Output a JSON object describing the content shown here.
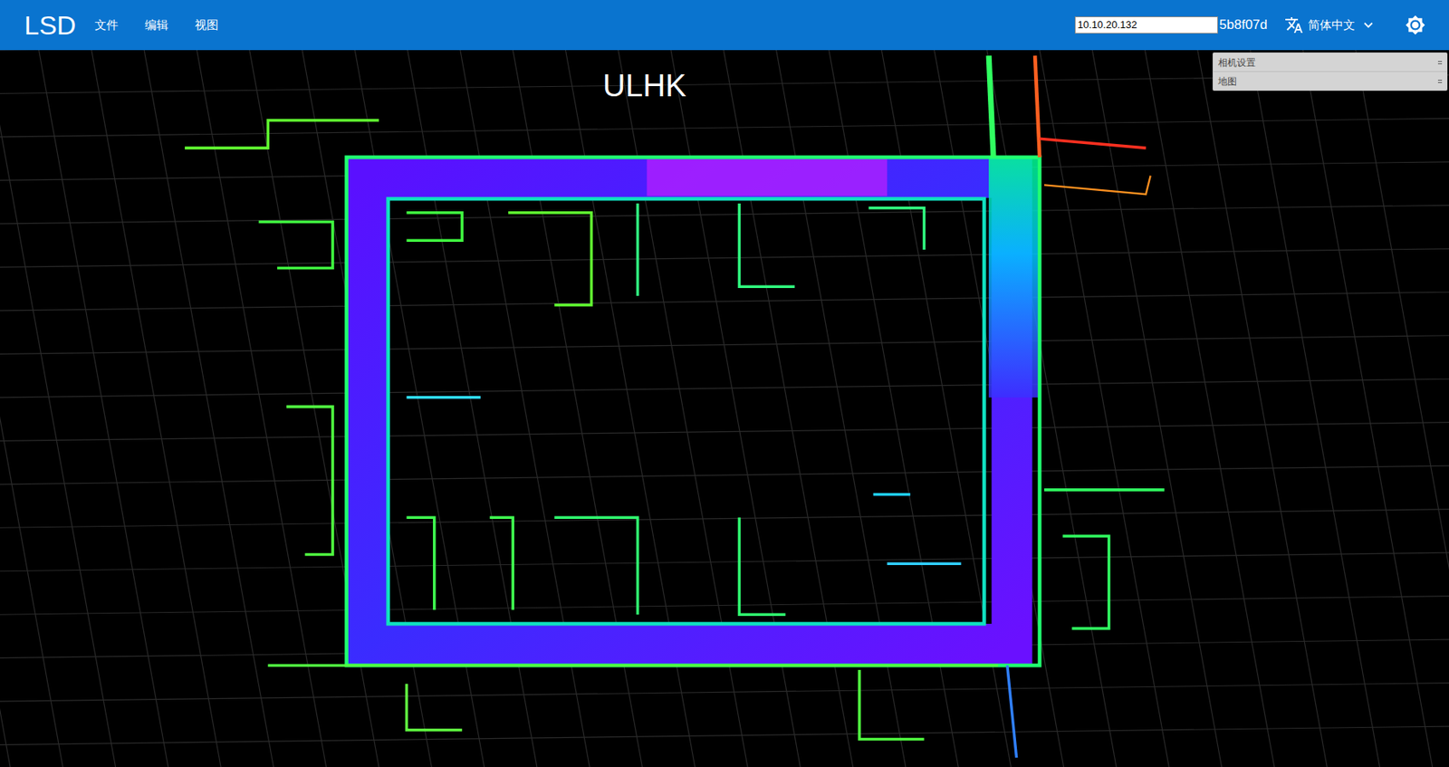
{
  "app": {
    "title": "LSD"
  },
  "menu": [
    {
      "label": "文件"
    },
    {
      "label": "编辑"
    },
    {
      "label": "视图"
    }
  ],
  "host": {
    "value": "10.10.20.132"
  },
  "version": "5b8f07d",
  "language": {
    "label": "简体中文"
  },
  "canvas": {
    "title": "ULHK"
  },
  "gui_panel": {
    "folders": [
      {
        "label": "相机设置",
        "expanded": false
      },
      {
        "label": "地图",
        "expanded": false
      }
    ]
  }
}
